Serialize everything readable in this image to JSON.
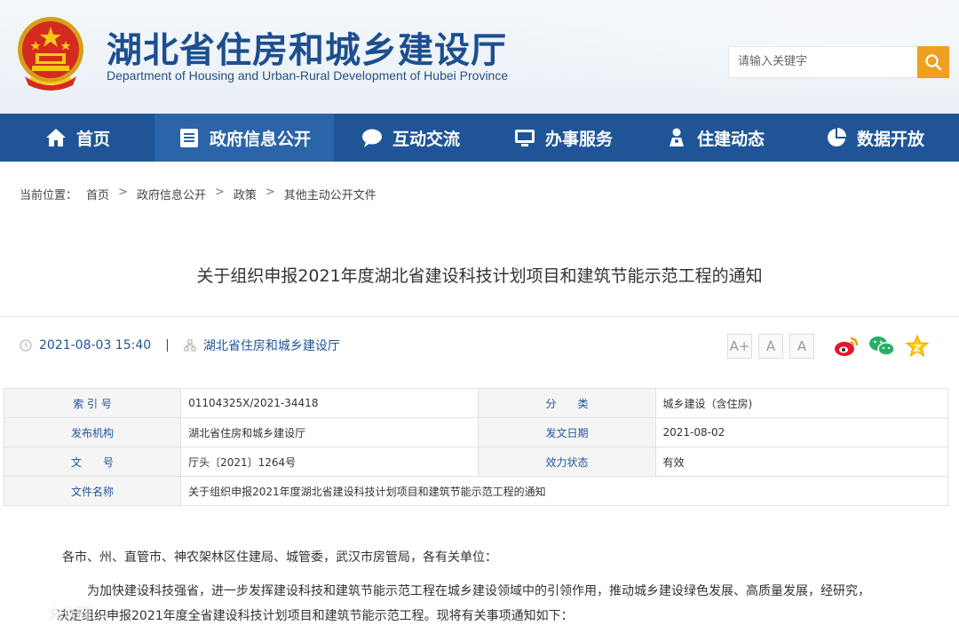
{
  "header": {
    "title": "湖北省住房和城乡建设厅",
    "subtitle": "Department of Housing and Urban-Rural Development of Hubei Province",
    "search_placeholder": "请输入关键字"
  },
  "nav": [
    {
      "label": "首页",
      "icon": "home-icon"
    },
    {
      "label": "政府信息公开",
      "icon": "document-list-icon",
      "active": true
    },
    {
      "label": "互动交流",
      "icon": "chat-bubble-icon"
    },
    {
      "label": "办事服务",
      "icon": "monitor-icon"
    },
    {
      "label": "住建动态",
      "icon": "person-pin-icon"
    },
    {
      "label": "数据开放",
      "icon": "pie-chart-icon"
    }
  ],
  "breadcrumb": {
    "prefix": "当前位置：",
    "items": [
      "首页",
      "政府信息公开",
      "政策",
      "其他主动公开文件"
    ],
    "separator": ">"
  },
  "article": {
    "title": "关于组织申报2021年度湖北省建设科技计划项目和建筑节能示范工程的通知",
    "datetime": "2021-08-03 15:40",
    "meta_separator": "|",
    "source": "湖北省住房和城乡建设厅"
  },
  "font_sizes": [
    "A+",
    "A",
    "A"
  ],
  "info": {
    "index_label": "索 引 号",
    "index_value": "01104325X/2021-34418",
    "category_label": "分　　类",
    "category_value": "城乡建设（含住房)",
    "publisher_label": "发布机构",
    "publisher_value": "湖北省住房和城乡建设厅",
    "date_label": "发文日期",
    "date_value": "2021-08-02",
    "docno_label": "文　　号",
    "docno_value": "厅头〔2021〕1264号",
    "status_label": "效力状态",
    "status_value": "有效",
    "filename_label": "文件名称",
    "filename_value": "关于组织申报2021年度湖北省建设科技计划项目和建筑节能示范工程的通知"
  },
  "body": {
    "salutation": "各市、州、直管市、神农架林区住建局、城管委，武汉市房管局，各有关单位：",
    "paragraph1": "为加快建设科技强省，进一步发挥建设科技和建筑节能示范工程在城乡建设领域中的引领作用，推动城乡建设绿色发展、高质量发展，经研究，",
    "paragraph2": "决定组织申报2021年度全省建设科技计划项目和建筑节能示范工程。现将有关事项通知如下："
  },
  "watermark": "大众网"
}
